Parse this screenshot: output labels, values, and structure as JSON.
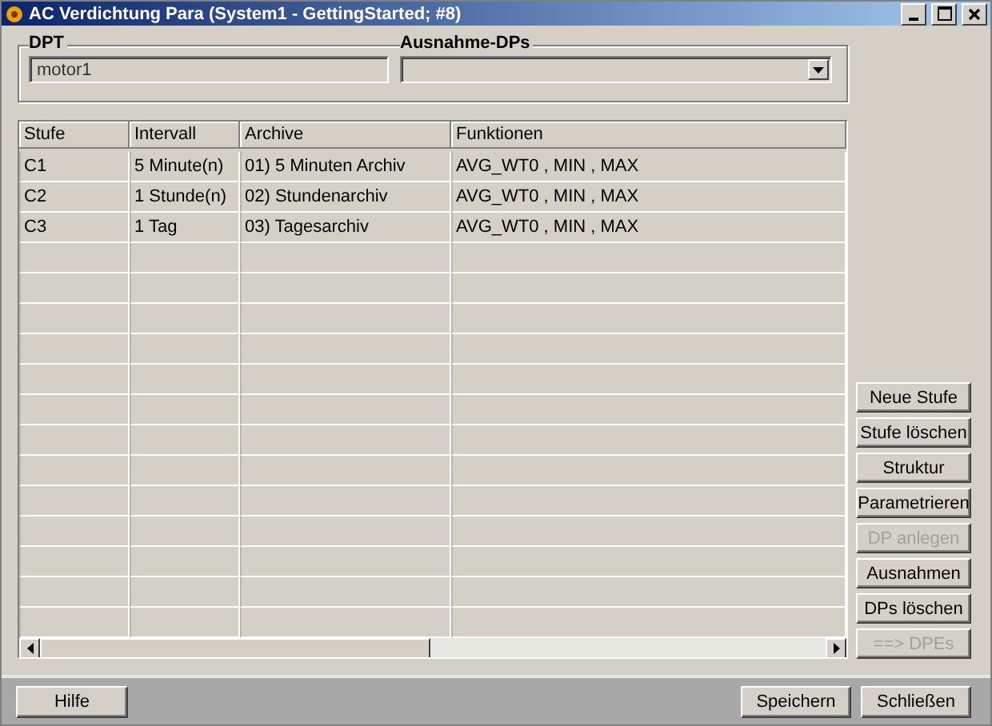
{
  "window": {
    "title": "AC Verdichtung Para (System1 - GettingStarted; #8)"
  },
  "dpt": {
    "label": "DPT",
    "value": "motor1"
  },
  "exceptions": {
    "label": "Ausnahme-DPs"
  },
  "table": {
    "columns": [
      "Stufe",
      "Intervall",
      "Archive",
      "Funktionen"
    ],
    "rows": [
      [
        "C1",
        "5 Minute(n)",
        "01) 5 Minuten Archiv",
        "AVG_WT0 , MIN , MAX"
      ],
      [
        "C2",
        "1 Stunde(n)",
        "02) Stundenarchiv",
        "AVG_WT0 , MIN , MAX"
      ],
      [
        "C3",
        "1 Tag",
        "03) Tagesarchiv",
        "AVG_WT0 , MIN , MAX"
      ]
    ]
  },
  "side_buttons": [
    {
      "label": "Neue Stufe",
      "disabled": false
    },
    {
      "label": "Stufe löschen",
      "disabled": false
    },
    {
      "label": "Struktur",
      "disabled": false
    },
    {
      "label": "Parametrieren",
      "disabled": false
    },
    {
      "label": "DP anlegen",
      "disabled": true
    },
    {
      "label": "Ausnahmen",
      "disabled": false
    },
    {
      "label": "DPs löschen",
      "disabled": false
    },
    {
      "label": "==> DPEs",
      "disabled": true
    }
  ],
  "footer": {
    "left": [
      "Hilfe"
    ],
    "right": [
      "Speichern",
      "Schließen"
    ]
  }
}
